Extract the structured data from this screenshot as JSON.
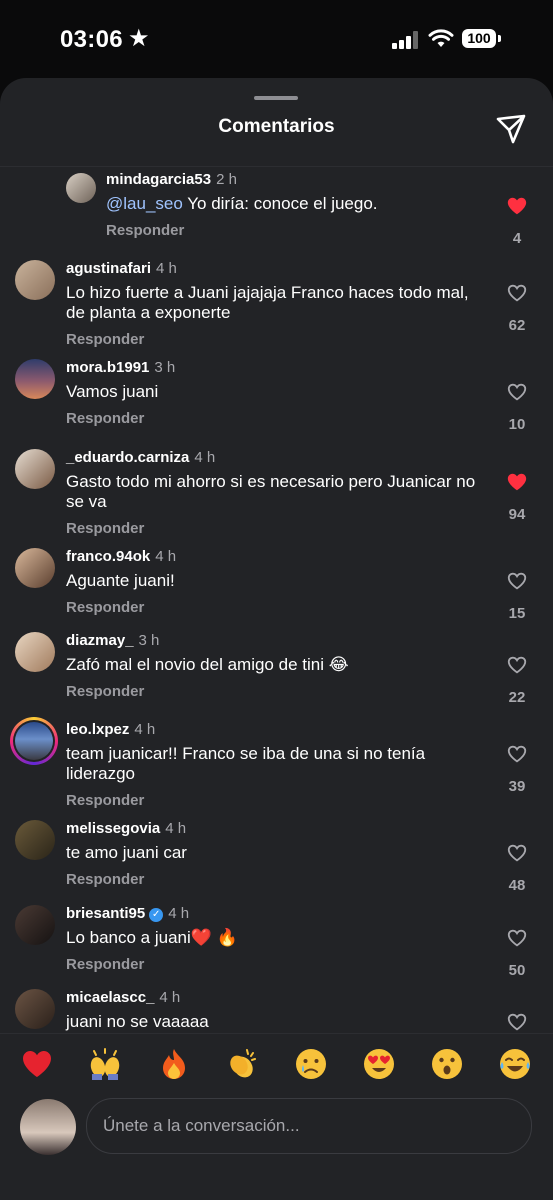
{
  "status": {
    "time": "03:06",
    "battery": "100"
  },
  "sheet": {
    "title": "Comentarios",
    "reply_label": "Responder"
  },
  "comments": [
    {
      "user": "mindagarcia53",
      "time": "2 h",
      "mention": "@lau_seo",
      "text": "Yo diría: conoce el juego.",
      "likes": "4",
      "liked": true
    },
    {
      "user": "agustinafari",
      "time": "4 h",
      "text": "Lo hizo fuerte a Juani jajajaja Franco haces todo mal, de planta a exponerte",
      "likes": "62",
      "liked": false
    },
    {
      "user": "mora.b1991",
      "time": "3 h",
      "text": "Vamos juani",
      "likes": "10",
      "liked": false
    },
    {
      "user": "_eduardo.carniza",
      "time": "4 h",
      "text": "Gasto todo mi ahorro si es necesario pero Juanicar no se va",
      "likes": "94",
      "liked": true
    },
    {
      "user": "franco.94ok",
      "time": "4 h",
      "text": "Aguante juani!",
      "likes": "15",
      "liked": false
    },
    {
      "user": "diazmay_",
      "time": "3 h",
      "text": "Zafó mal el novio del amigo de tini 😂",
      "likes": "22",
      "liked": false
    },
    {
      "user": "leo.lxpez",
      "time": "4 h",
      "text": "team juanicar!! Franco se iba de una si no tenía liderazgo",
      "likes": "39",
      "liked": false
    },
    {
      "user": "melissegovia",
      "time": "4 h",
      "text": "te amo juani car",
      "likes": "48",
      "liked": false
    },
    {
      "user": "briesanti95",
      "time": "4 h",
      "text": "Lo banco a juani❤️ 🔥",
      "likes": "50",
      "liked": false,
      "verified": true
    },
    {
      "user": "micaelascc_",
      "time": "4 h",
      "text": "juani no se vaaaaa",
      "likes": "",
      "liked": false
    }
  ],
  "quick_reactions": [
    "red-heart",
    "raised-hands",
    "fire",
    "clapping-hands",
    "crying-face",
    "heart-eyes",
    "surprised-face",
    "tears-of-joy"
  ],
  "composer": {
    "placeholder": "Únete a la conversación..."
  },
  "colors": {
    "liked": "#ff3040",
    "sheet_bg": "#222326",
    "mention": "#a0c4ff"
  }
}
